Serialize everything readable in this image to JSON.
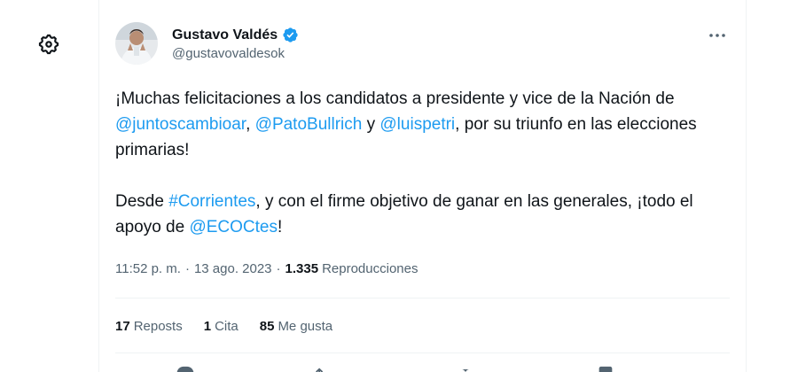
{
  "author": {
    "display_name": "Gustavo Valdés",
    "handle": "@gustavovaldesok",
    "verified": true
  },
  "tweet": {
    "line1_pre": "¡Muchas felicitaciones a los candidatos a presidente y vice de la Nación de ",
    "mention1": "@juntoscambioar",
    "line1_mid1": ", ",
    "mention2": "@PatoBullrich",
    "line1_mid2": " y ",
    "mention3": "@luispetri",
    "line1_post": ", por su triunfo en las elecciones primarias!",
    "line2_pre": "Desde ",
    "hashtag1": "#Corrientes",
    "line2_mid": ", y con el firme objetivo de ganar en las generales, ¡todo el apoyo de ",
    "mention4": "@ECOCtes",
    "line2_post": "!"
  },
  "meta": {
    "time": "11:52 p. m.",
    "separator": "·",
    "date": "13 ago. 2023",
    "views_count": "1.335",
    "views_label": "Reproducciones"
  },
  "stats": {
    "reposts_count": "17",
    "reposts_label": "Reposts",
    "quotes_count": "1",
    "quotes_label": "Cita",
    "likes_count": "85",
    "likes_label": "Me gusta"
  },
  "icons": {
    "settings": "gear-icon",
    "verified": "verified-badge-icon",
    "more": "more-horizontal-icon",
    "reply": "reply-icon",
    "repost": "repost-icon",
    "like": "heart-icon",
    "bookmark": "bookmark-icon",
    "share": "share-icon"
  },
  "colors": {
    "accent": "#1d9bf0",
    "text": "#0f1419",
    "muted": "#536471",
    "divider": "#eff3f4"
  }
}
